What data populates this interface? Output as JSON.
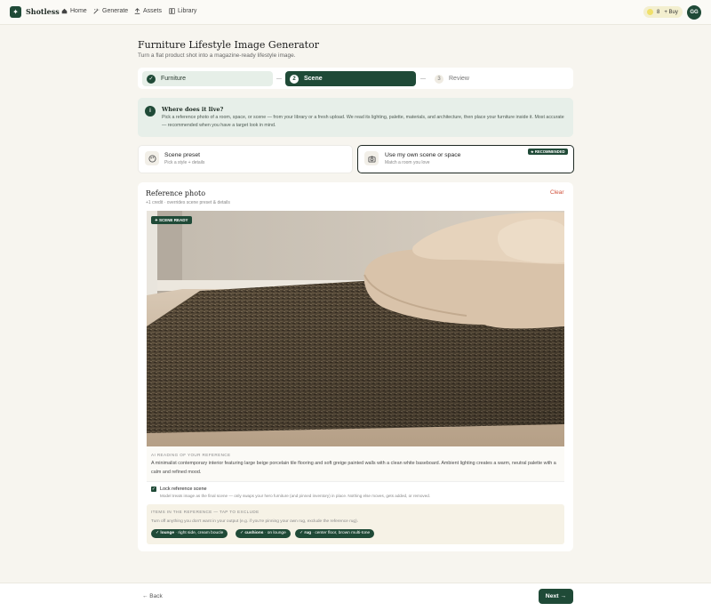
{
  "brand": {
    "name": "Shotless",
    "logo_icon": "sparkle-icon"
  },
  "nav": [
    {
      "label": "Home",
      "icon": "home-icon"
    },
    {
      "label": "Generate",
      "icon": "magic-icon"
    },
    {
      "label": "Assets",
      "icon": "upload-icon"
    },
    {
      "label": "Library",
      "icon": "library-icon"
    }
  ],
  "credits": {
    "count": "8",
    "buy_label": "+ Buy"
  },
  "user": {
    "initials": "GG"
  },
  "header": {
    "title": "Furniture Lifestyle Image Generator",
    "subtitle": "Turn a flat product shot into a magazine-ready lifestyle image."
  },
  "steps": [
    {
      "label": "Furniture",
      "state": "done"
    },
    {
      "number": "2",
      "label": "Scene",
      "state": "active"
    },
    {
      "number": "3",
      "label": "Review",
      "state": "todo"
    }
  ],
  "info": {
    "title": "Where does it live?",
    "text": "Pick a reference photo of a room, space, or scene — from your library or a fresh upload. We read its lighting, palette, materials, and architecture, then place your furniture inside it. Most accurate — recommended when you have a target look in mind."
  },
  "options": [
    {
      "title": "Scene preset",
      "subtitle": "Pick a style + details",
      "icon": "palette-icon"
    },
    {
      "title": "Use my own scene or space",
      "subtitle": "Match a room you love",
      "icon": "camera-icon",
      "badge": "★ RECOMMENDED"
    }
  ],
  "reference": {
    "title": "Reference photo",
    "subtitle": "+1 credit · overrides scene preset & details",
    "clear_label": "Clear",
    "ready_badge": "✦ SCENE READY",
    "ai_label": "AI READING OF YOUR REFERENCE",
    "ai_text": "A minimalist contemporary interior featuring large beige porcelain tile flooring and soft greige painted walls with a clean white baseboard. Ambient lighting creates a warm, neutral palette with a calm and refined mood.",
    "lock_title": "Lock reference scene",
    "lock_sub": "Model treats image as the final scene — only swaps your hero furniture (and pinned inventory) in place. Nothing else moves, gets added, or removed.",
    "exclude_label": "ITEMS IN THE REFERENCE — TAP TO EXCLUDE",
    "exclude_sub": "Turn off anything you don't want in your output (e.g. if you're pinning your own rug, exclude the reference rug).",
    "items": [
      {
        "name": "lounge",
        "detail": "right side, cream boucle"
      },
      {
        "name": "cushions",
        "detail": "on lounge"
      },
      {
        "name": "rug",
        "detail": "center floor, brown multi-tone"
      }
    ]
  },
  "footer": {
    "back_label": "← Back",
    "next_label": "Next →"
  },
  "colors": {
    "accent": "#1f4a37",
    "background": "#f7f5ef",
    "clear": "#d0503a"
  }
}
